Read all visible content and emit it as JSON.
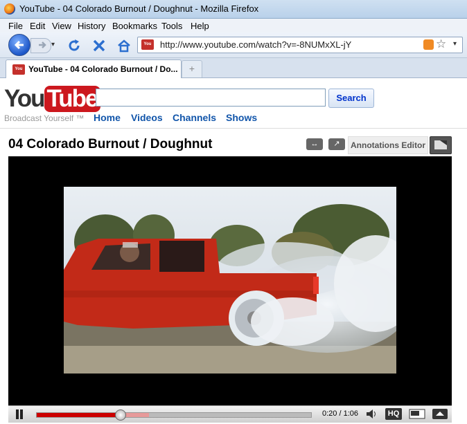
{
  "window": {
    "title": "YouTube - 04 Colorado Burnout / Doughnut - Mozilla Firefox"
  },
  "menu": [
    {
      "label": "File",
      "key": "F"
    },
    {
      "label": "Edit",
      "key": "E"
    },
    {
      "label": "View",
      "key": "V"
    },
    {
      "label": "History",
      "key": "s"
    },
    {
      "label": "Bookmarks",
      "key": "B"
    },
    {
      "label": "Tools",
      "key": "T"
    },
    {
      "label": "Help",
      "key": "H"
    }
  ],
  "address": {
    "url": "http://www.youtube.com/watch?v=-8NUMxXL-jY"
  },
  "tab": {
    "label": "YouTube - 04 Colorado Burnout / Do..."
  },
  "youtube": {
    "logo_you": "You",
    "logo_tube": "Tube",
    "tagline": "Broadcast Yourself ™",
    "search_button": "Search",
    "nav": [
      "Home",
      "Videos",
      "Channels",
      "Shows"
    ]
  },
  "video": {
    "title": "04 Colorado Burnout / Doughnut",
    "annotations_label": "Annotations Editor",
    "timecode": "0:20 / 1:06",
    "progress_fraction": 0.303,
    "loaded_fraction": 0.41,
    "hq_label": "HQ"
  },
  "colors": {
    "youtube_red": "#cc181e",
    "link_blue": "#1155aa",
    "truck_red": "#c22a18"
  }
}
